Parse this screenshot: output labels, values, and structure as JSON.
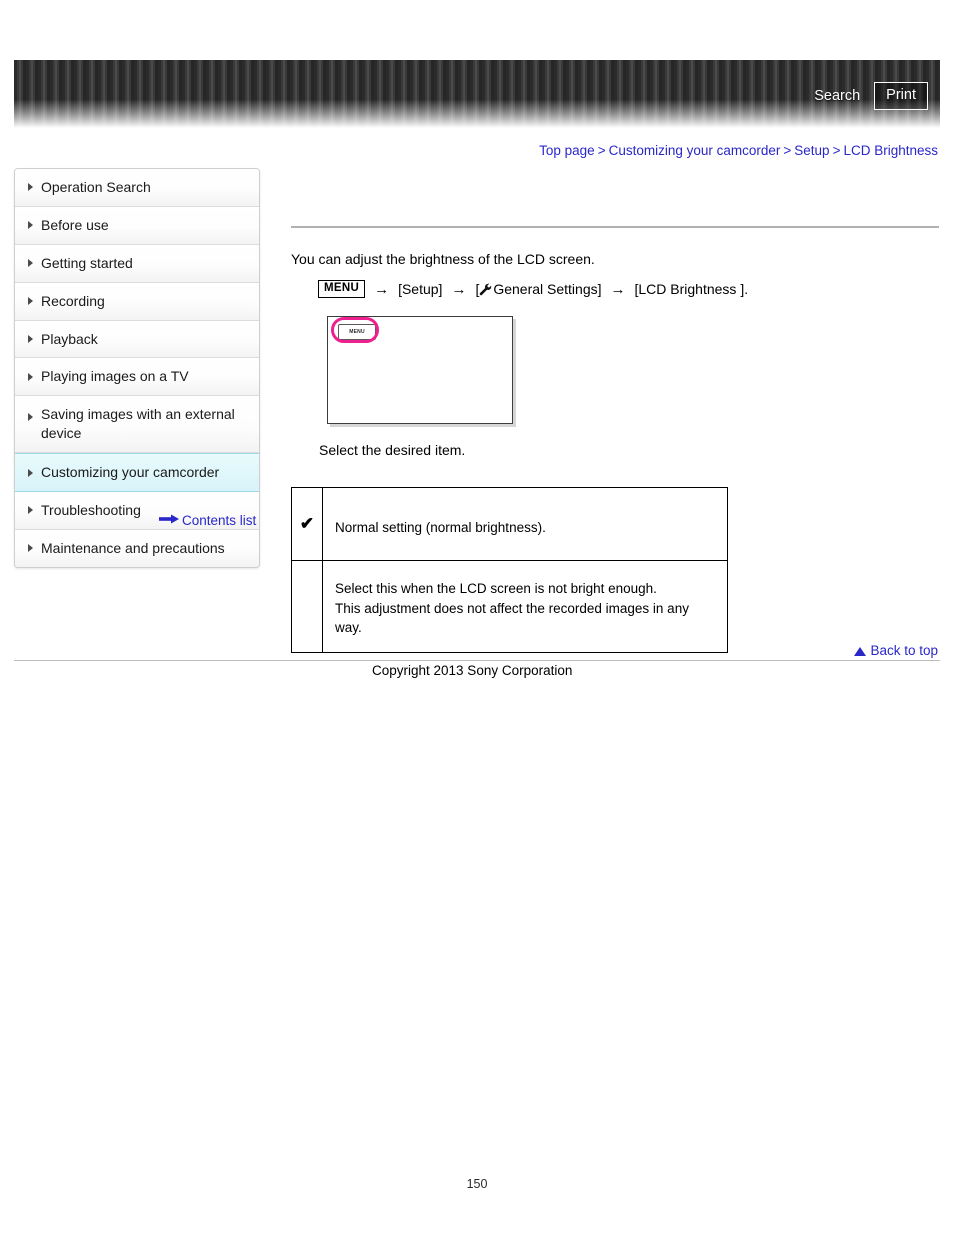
{
  "header": {
    "search_label": "Search",
    "print_label": "Print"
  },
  "breadcrumb": {
    "items": [
      {
        "label": "Top page"
      },
      {
        "label": "Customizing your camcorder"
      },
      {
        "label": "Setup"
      },
      {
        "label": "LCD Brightness"
      }
    ],
    "separator": ">"
  },
  "sidebar": {
    "items": [
      {
        "label": "Operation Search",
        "active": false
      },
      {
        "label": "Before use",
        "active": false
      },
      {
        "label": "Getting started",
        "active": false
      },
      {
        "label": "Recording",
        "active": false
      },
      {
        "label": "Playback",
        "active": false
      },
      {
        "label": "Playing images on a TV",
        "active": false
      },
      {
        "label": "Saving images with an external device",
        "active": false
      },
      {
        "label": "Customizing your camcorder",
        "active": true
      },
      {
        "label": "Troubleshooting",
        "active": false
      },
      {
        "label": "Maintenance and precautions",
        "active": false
      }
    ],
    "contents_list_label": "Contents list"
  },
  "main": {
    "intro": "You can adjust the brightness of the LCD screen.",
    "path": {
      "menu_chip": "MENU",
      "arrow": "→",
      "step_setup": "[Setup]",
      "step_general_open": "[",
      "step_general": "General Settings]",
      "step_lcd": "[LCD Brightness ]."
    },
    "figure": {
      "menu_button_label": "MENU"
    },
    "select_instruction": "Select the desired item.",
    "table": {
      "rows": [
        {
          "check": "✔",
          "description": "Normal setting (normal brightness)."
        },
        {
          "check": "",
          "description": "Select this when the LCD screen is not bright enough.\nThis adjustment does not affect the recorded images in any way."
        }
      ]
    }
  },
  "footer": {
    "back_to_top_label": "Back to top",
    "copyright": "Copyright 2013 Sony Corporation",
    "page_number": "150"
  },
  "colors": {
    "link": "#2a27c8",
    "highlight_pink": "#ee1f8e",
    "sidebar_active": "#d8f3f9",
    "header_dark": "#2b2b2b"
  }
}
